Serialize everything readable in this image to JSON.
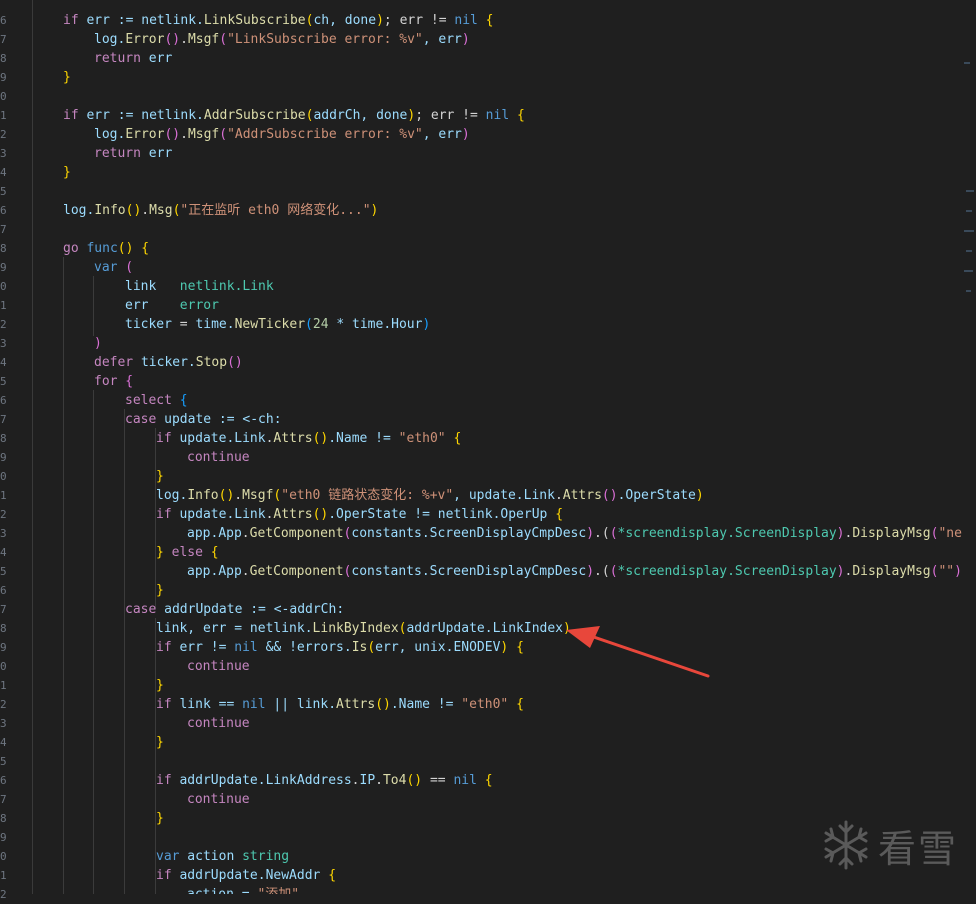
{
  "gutter": {
    "line_numbers": [
      "6",
      "7",
      "8",
      "9",
      "0",
      "1",
      "2",
      "3",
      "4",
      "5",
      "6",
      "7",
      "8",
      "9",
      "0",
      "1",
      "2",
      "3",
      "4",
      "5",
      "6",
      "7",
      "8",
      "9",
      "0",
      "1",
      "2",
      "3",
      "4",
      "5",
      "6",
      "7",
      "8",
      "9",
      "0",
      "1",
      "2",
      "3",
      "4",
      "5",
      "6",
      "7",
      "8",
      "9",
      "0",
      "1",
      "2"
    ]
  },
  "watermark": {
    "text": "看雪"
  },
  "colors": {
    "background": "#1f1f1f",
    "keyword": "#569cd6",
    "control": "#c586c0",
    "variable": "#9cdcfe",
    "function": "#dcdcaa",
    "type": "#4ec9b0",
    "string": "#ce9178",
    "number": "#b5cea8",
    "arrow": "#e8473b"
  },
  "code": [
    {
      "indent": 0,
      "tokens": [
        [
          "if",
          "ctrl"
        ],
        [
          " err := netlink.",
          "var"
        ],
        [
          "LinkSubscribe",
          "fn"
        ],
        [
          "(",
          "b1"
        ],
        [
          "ch, done",
          "var"
        ],
        [
          ")",
          "b1"
        ],
        [
          "; err != ",
          "op"
        ],
        [
          "nil",
          "kw"
        ],
        [
          " {",
          "b1"
        ]
      ]
    },
    {
      "indent": 1,
      "tokens": [
        [
          "log.",
          "var"
        ],
        [
          "Error",
          "fn"
        ],
        [
          "()",
          "b2"
        ],
        [
          ".",
          "op"
        ],
        [
          "Msgf",
          "fn"
        ],
        [
          "(",
          "b2"
        ],
        [
          "\"LinkSubscribe error: %v\"",
          "str"
        ],
        [
          ", err",
          "var"
        ],
        [
          ")",
          "b2"
        ]
      ]
    },
    {
      "indent": 1,
      "tokens": [
        [
          "return",
          "ctrl"
        ],
        [
          " err",
          "var"
        ]
      ]
    },
    {
      "indent": 0,
      "tokens": [
        [
          "}",
          "b1"
        ]
      ]
    },
    {
      "indent": 0,
      "tokens": []
    },
    {
      "indent": 0,
      "tokens": [
        [
          "if",
          "ctrl"
        ],
        [
          " err := netlink.",
          "var"
        ],
        [
          "AddrSubscribe",
          "fn"
        ],
        [
          "(",
          "b1"
        ],
        [
          "addrCh, done",
          "var"
        ],
        [
          ")",
          "b1"
        ],
        [
          "; err != ",
          "op"
        ],
        [
          "nil",
          "kw"
        ],
        [
          " {",
          "b1"
        ]
      ]
    },
    {
      "indent": 1,
      "tokens": [
        [
          "log.",
          "var"
        ],
        [
          "Error",
          "fn"
        ],
        [
          "()",
          "b2"
        ],
        [
          ".",
          "op"
        ],
        [
          "Msgf",
          "fn"
        ],
        [
          "(",
          "b2"
        ],
        [
          "\"AddrSubscribe error: %v\"",
          "str"
        ],
        [
          ", err",
          "var"
        ],
        [
          ")",
          "b2"
        ]
      ]
    },
    {
      "indent": 1,
      "tokens": [
        [
          "return",
          "ctrl"
        ],
        [
          " err",
          "var"
        ]
      ]
    },
    {
      "indent": 0,
      "tokens": [
        [
          "}",
          "b1"
        ]
      ]
    },
    {
      "indent": 0,
      "tokens": []
    },
    {
      "indent": 0,
      "tokens": [
        [
          "log.",
          "var"
        ],
        [
          "Info",
          "fn"
        ],
        [
          "()",
          "b1"
        ],
        [
          ".",
          "op"
        ],
        [
          "Msg",
          "fn"
        ],
        [
          "(",
          "b1"
        ],
        [
          "\"正在监听 eth0 网络变化...\"",
          "str"
        ],
        [
          ")",
          "b1"
        ]
      ]
    },
    {
      "indent": 0,
      "tokens": []
    },
    {
      "indent": 0,
      "tokens": [
        [
          "go",
          "ctrl"
        ],
        [
          " ",
          "op"
        ],
        [
          "func",
          "kw"
        ],
        [
          "()",
          "b1"
        ],
        [
          " {",
          "b1"
        ]
      ]
    },
    {
      "indent": 1,
      "tokens": [
        [
          "var",
          "kw"
        ],
        [
          " (",
          "b2"
        ]
      ]
    },
    {
      "indent": 2,
      "tokens": [
        [
          "link",
          "var"
        ],
        [
          "   netlink.",
          "type"
        ],
        [
          "Link",
          "type"
        ]
      ]
    },
    {
      "indent": 2,
      "tokens": [
        [
          "err",
          "var"
        ],
        [
          "    ",
          "op"
        ],
        [
          "error",
          "type"
        ]
      ]
    },
    {
      "indent": 2,
      "tokens": [
        [
          "ticker",
          "var"
        ],
        [
          " = ",
          "op"
        ],
        [
          "time.",
          "var"
        ],
        [
          "NewTicker",
          "fn"
        ],
        [
          "(",
          "b3"
        ],
        [
          "24",
          "num"
        ],
        [
          " * time.",
          "var"
        ],
        [
          "Hour",
          "var"
        ],
        [
          ")",
          "b3"
        ]
      ]
    },
    {
      "indent": 1,
      "tokens": [
        [
          ")",
          "b2"
        ]
      ]
    },
    {
      "indent": 1,
      "tokens": [
        [
          "defer",
          "ctrl"
        ],
        [
          " ticker.",
          "var"
        ],
        [
          "Stop",
          "fn"
        ],
        [
          "()",
          "b2"
        ]
      ]
    },
    {
      "indent": 1,
      "tokens": [
        [
          "for",
          "ctrl"
        ],
        [
          " {",
          "b2"
        ]
      ]
    },
    {
      "indent": 2,
      "tokens": [
        [
          "select",
          "ctrl"
        ],
        [
          " {",
          "b3"
        ]
      ]
    },
    {
      "indent": 2,
      "tokens": [
        [
          "case",
          "ctrl"
        ],
        [
          " update := <-ch:",
          "var"
        ]
      ]
    },
    {
      "indent": 3,
      "tokens": [
        [
          "if",
          "ctrl"
        ],
        [
          " update.",
          "var"
        ],
        [
          "Link",
          "var"
        ],
        [
          ".",
          "op"
        ],
        [
          "Attrs",
          "fn"
        ],
        [
          "()",
          "b1"
        ],
        [
          ".Name != ",
          "var"
        ],
        [
          "\"eth0\"",
          "str"
        ],
        [
          " {",
          "b1"
        ]
      ]
    },
    {
      "indent": 4,
      "tokens": [
        [
          "continue",
          "ctrl"
        ]
      ]
    },
    {
      "indent": 3,
      "tokens": [
        [
          "}",
          "b1"
        ]
      ]
    },
    {
      "indent": 3,
      "tokens": [
        [
          "log.",
          "var"
        ],
        [
          "Info",
          "fn"
        ],
        [
          "()",
          "b1"
        ],
        [
          ".",
          "op"
        ],
        [
          "Msgf",
          "fn"
        ],
        [
          "(",
          "b1"
        ],
        [
          "\"eth0 链路状态变化: %+v\"",
          "str"
        ],
        [
          ", update.",
          "var"
        ],
        [
          "Link",
          "var"
        ],
        [
          ".",
          "op"
        ],
        [
          "Attrs",
          "fn"
        ],
        [
          "()",
          "b2"
        ],
        [
          ".OperState",
          "var"
        ],
        [
          ")",
          "b1"
        ]
      ]
    },
    {
      "indent": 3,
      "tokens": [
        [
          "if",
          "ctrl"
        ],
        [
          " update.",
          "var"
        ],
        [
          "Link",
          "var"
        ],
        [
          ".",
          "op"
        ],
        [
          "Attrs",
          "fn"
        ],
        [
          "()",
          "b1"
        ],
        [
          ".OperState != netlink.",
          "var"
        ],
        [
          "OperUp",
          "var"
        ],
        [
          " {",
          "b1"
        ]
      ]
    },
    {
      "indent": 4,
      "tokens": [
        [
          "app.",
          "var"
        ],
        [
          "App",
          "var"
        ],
        [
          ".",
          "op"
        ],
        [
          "GetComponent",
          "fn"
        ],
        [
          "(",
          "b2"
        ],
        [
          "constants.",
          "var"
        ],
        [
          "ScreenDisplayCmpDesc",
          "var"
        ],
        [
          ")",
          "b2"
        ],
        [
          ".(",
          "op"
        ],
        [
          "(",
          "b2"
        ],
        [
          "*screendisplay.",
          "type"
        ],
        [
          "ScreenDisplay",
          "type"
        ],
        [
          ")",
          "b2"
        ],
        [
          ".",
          "op"
        ],
        [
          "DisplayMsg",
          "fn"
        ],
        [
          "(",
          "b2"
        ],
        [
          "\"netwo",
          "str"
        ]
      ]
    },
    {
      "indent": 3,
      "tokens": [
        [
          "}",
          "b1"
        ],
        [
          " else ",
          "ctrl"
        ],
        [
          "{",
          "b1"
        ]
      ]
    },
    {
      "indent": 4,
      "tokens": [
        [
          "app.",
          "var"
        ],
        [
          "App",
          "var"
        ],
        [
          ".",
          "op"
        ],
        [
          "GetComponent",
          "fn"
        ],
        [
          "(",
          "b2"
        ],
        [
          "constants.",
          "var"
        ],
        [
          "ScreenDisplayCmpDesc",
          "var"
        ],
        [
          ")",
          "b2"
        ],
        [
          ".(",
          "op"
        ],
        [
          "(",
          "b2"
        ],
        [
          "*screendisplay.",
          "type"
        ],
        [
          "ScreenDisplay",
          "type"
        ],
        [
          ")",
          "b2"
        ],
        [
          ".",
          "op"
        ],
        [
          "DisplayMsg",
          "fn"
        ],
        [
          "(",
          "b2"
        ],
        [
          "\"\"",
          "str"
        ],
        [
          ")",
          "b2"
        ]
      ]
    },
    {
      "indent": 3,
      "tokens": [
        [
          "}",
          "b1"
        ]
      ]
    },
    {
      "indent": 2,
      "tokens": [
        [
          "case",
          "ctrl"
        ],
        [
          " addrUpdate := <-addrCh:",
          "var"
        ]
      ]
    },
    {
      "indent": 3,
      "tokens": [
        [
          "link, err = netlink.",
          "var"
        ],
        [
          "LinkByIndex",
          "fn"
        ],
        [
          "(",
          "b1"
        ],
        [
          "addrUpdate.",
          "var"
        ],
        [
          "LinkIndex",
          "var"
        ],
        [
          ")",
          "b1"
        ]
      ]
    },
    {
      "indent": 3,
      "tokens": [
        [
          "if",
          "ctrl"
        ],
        [
          " err != ",
          "var"
        ],
        [
          "nil",
          "kw"
        ],
        [
          " && !errors.",
          "var"
        ],
        [
          "Is",
          "fn"
        ],
        [
          "(",
          "b1"
        ],
        [
          "err, unix.",
          "var"
        ],
        [
          "ENODEV",
          "var"
        ],
        [
          ")",
          "b1"
        ],
        [
          " {",
          "b1"
        ]
      ]
    },
    {
      "indent": 4,
      "tokens": [
        [
          "continue",
          "ctrl"
        ]
      ]
    },
    {
      "indent": 3,
      "tokens": [
        [
          "}",
          "b1"
        ]
      ]
    },
    {
      "indent": 3,
      "tokens": [
        [
          "if",
          "ctrl"
        ],
        [
          " link == ",
          "var"
        ],
        [
          "nil",
          "kw"
        ],
        [
          " || link.",
          "var"
        ],
        [
          "Attrs",
          "fn"
        ],
        [
          "()",
          "b1"
        ],
        [
          ".Name != ",
          "var"
        ],
        [
          "\"eth0\"",
          "str"
        ],
        [
          " {",
          "b1"
        ]
      ]
    },
    {
      "indent": 4,
      "tokens": [
        [
          "continue",
          "ctrl"
        ]
      ]
    },
    {
      "indent": 3,
      "tokens": [
        [
          "}",
          "b1"
        ]
      ]
    },
    {
      "indent": 0,
      "tokens": []
    },
    {
      "indent": 3,
      "tokens": [
        [
          "if",
          "ctrl"
        ],
        [
          " addrUpdate.",
          "var"
        ],
        [
          "LinkAddress",
          "var"
        ],
        [
          ".",
          "op"
        ],
        [
          "IP",
          "var"
        ],
        [
          ".",
          "op"
        ],
        [
          "To4",
          "fn"
        ],
        [
          "()",
          "b1"
        ],
        [
          " == ",
          "op"
        ],
        [
          "nil",
          "kw"
        ],
        [
          " {",
          "b1"
        ]
      ]
    },
    {
      "indent": 4,
      "tokens": [
        [
          "continue",
          "ctrl"
        ]
      ]
    },
    {
      "indent": 3,
      "tokens": [
        [
          "}",
          "b1"
        ]
      ]
    },
    {
      "indent": 0,
      "tokens": []
    },
    {
      "indent": 3,
      "tokens": [
        [
          "var",
          "kw"
        ],
        [
          " action ",
          "var"
        ],
        [
          "string",
          "type"
        ]
      ]
    },
    {
      "indent": 3,
      "tokens": [
        [
          "if",
          "ctrl"
        ],
        [
          " addrUpdate.",
          "var"
        ],
        [
          "NewAddr",
          "var"
        ],
        [
          " {",
          "b1"
        ]
      ]
    },
    {
      "indent": 4,
      "tokens": [
        [
          "action = ",
          "var"
        ],
        [
          "\"添加\"",
          "str"
        ]
      ]
    }
  ]
}
